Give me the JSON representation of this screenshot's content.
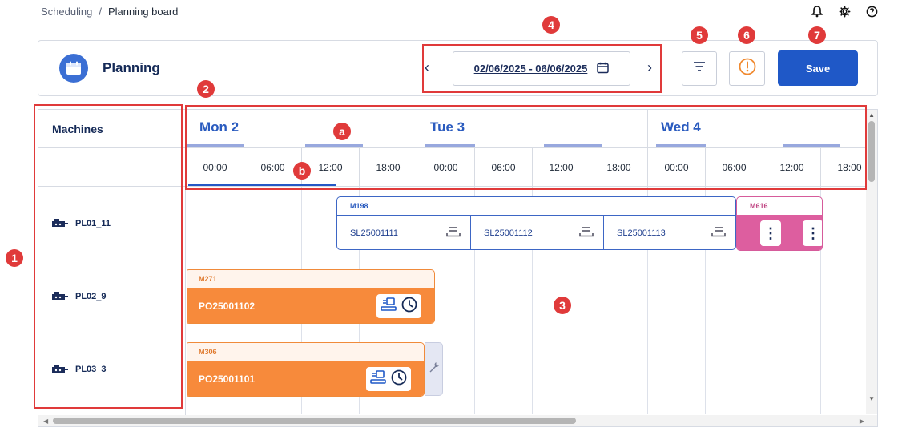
{
  "breadcrumb": {
    "parent": "Scheduling",
    "separator": "/",
    "current": "Planning board"
  },
  "header": {
    "title": "Planning",
    "date_range": "02/06/2025 - 06/06/2025",
    "save_label": "Save"
  },
  "board": {
    "machines_header": "Machines",
    "machines": [
      {
        "name": "PL01_11"
      },
      {
        "name": "PL02_9"
      },
      {
        "name": "PL03_3"
      }
    ],
    "days": [
      {
        "label": "Mon 2"
      },
      {
        "label": "Tue 3"
      },
      {
        "label": "Wed 4"
      }
    ],
    "hours": [
      "00:00",
      "06:00",
      "12:00",
      "18:00",
      "00:00",
      "06:00",
      "12:00",
      "18:00",
      "00:00",
      "06:00",
      "12:00",
      "18:00"
    ],
    "jobs": {
      "blue": {
        "code": "M198",
        "subjobs": [
          "SL25001111",
          "SL25001112",
          "SL25001113"
        ]
      },
      "pink": {
        "code": "M616"
      },
      "orange1": {
        "code": "M271",
        "order": "PO25001102"
      },
      "orange2": {
        "code": "M306",
        "order": "PO25001101"
      }
    }
  },
  "annotations": {
    "markers": [
      "1",
      "2",
      "3",
      "4",
      "5",
      "6",
      "7",
      "a",
      "b"
    ]
  },
  "colors": {
    "primary": "#1f58c7",
    "day_label": "#2a5bbf",
    "orange": "#f78a3b",
    "pink": "#dd5e9f",
    "annotation": "#e03a3a"
  }
}
